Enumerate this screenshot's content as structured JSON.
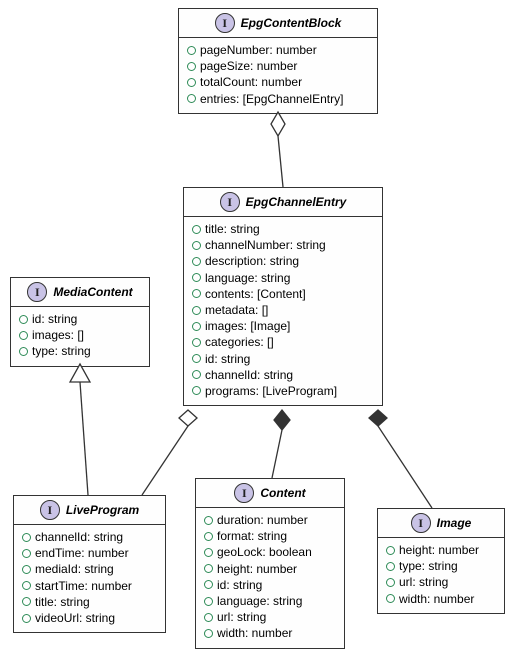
{
  "classes": {
    "epgContentBlock": {
      "name": "EpgContentBlock",
      "attrs": [
        "pageNumber: number",
        "pageSize: number",
        "totalCount: number",
        "entries: [EpgChannelEntry]"
      ]
    },
    "epgChannelEntry": {
      "name": "EpgChannelEntry",
      "attrs": [
        "title: string",
        "channelNumber: string",
        "description: string",
        "language: string",
        "contents: [Content]",
        "metadata: []",
        "images: [Image]",
        "categories: []",
        "id: string",
        "channelId: string",
        "programs: [LiveProgram]"
      ]
    },
    "mediaContent": {
      "name": "MediaContent",
      "attrs": [
        "id: string",
        "images: []",
        "type: string"
      ]
    },
    "liveProgram": {
      "name": "LiveProgram",
      "attrs": [
        "channelId: string",
        "endTime: number",
        "mediaId: string",
        "startTime: number",
        "title: string",
        "videoUrl: string"
      ]
    },
    "content": {
      "name": "Content",
      "attrs": [
        "duration: number",
        "format: string",
        "geoLock: boolean",
        "height: number",
        "id: string",
        "language: string",
        "url: string",
        "width: number"
      ]
    },
    "image": {
      "name": "Image",
      "attrs": [
        "height: number",
        "type: string",
        "url: string",
        "width: number"
      ]
    }
  },
  "relations": [
    {
      "from": "EpgContentBlock",
      "to": "EpgChannelEntry",
      "type": "aggregation"
    },
    {
      "from": "EpgChannelEntry",
      "to": "LiveProgram",
      "type": "aggregation"
    },
    {
      "from": "EpgChannelEntry",
      "to": "Content",
      "type": "composition"
    },
    {
      "from": "EpgChannelEntry",
      "to": "Image",
      "type": "composition"
    },
    {
      "from": "MediaContent",
      "to": "LiveProgram",
      "type": "generalization"
    }
  ],
  "chart_data": {
    "type": "diagram",
    "title": "UML Class Diagram",
    "nodes": [
      "EpgContentBlock",
      "EpgChannelEntry",
      "MediaContent",
      "LiveProgram",
      "Content",
      "Image"
    ],
    "edges": [
      {
        "from": "EpgContentBlock",
        "to": "EpgChannelEntry",
        "kind": "aggregation-open-diamond"
      },
      {
        "from": "EpgChannelEntry",
        "to": "LiveProgram",
        "kind": "aggregation-open-diamond"
      },
      {
        "from": "EpgChannelEntry",
        "to": "Content",
        "kind": "composition-filled-diamond"
      },
      {
        "from": "EpgChannelEntry",
        "to": "Image",
        "kind": "composition-filled-diamond"
      },
      {
        "from": "LiveProgram",
        "to": "MediaContent",
        "kind": "generalization-open-triangle"
      }
    ]
  }
}
